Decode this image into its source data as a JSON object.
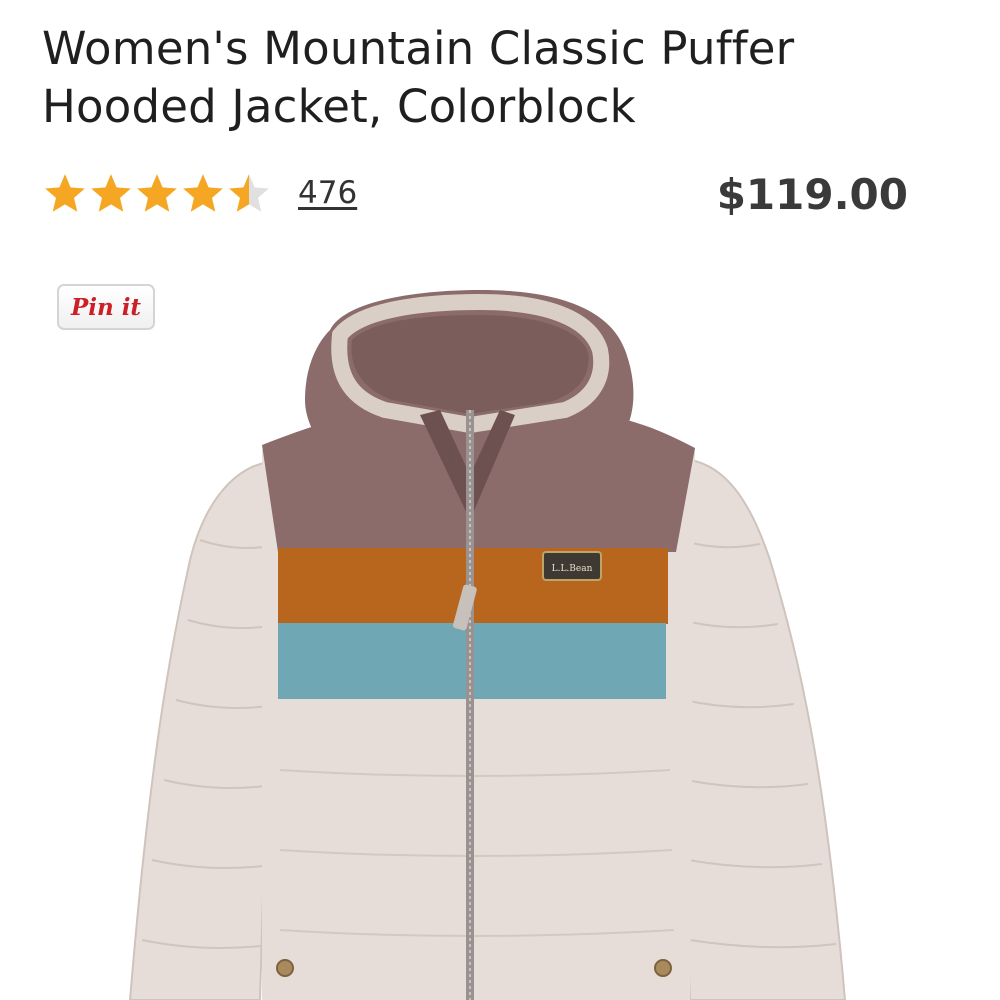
{
  "product": {
    "title": "Women's Mountain Classic Puffer Hooded Jacket, Colorblock",
    "rating_value": 4.5,
    "rating_max": 5,
    "review_count": "476",
    "price": "$119.00"
  },
  "share": {
    "pin_label": "Pin it"
  },
  "image": {
    "logo_text": "L.L.Bean",
    "colors": {
      "body": "#e7ddd8",
      "yoke": "#8b6c6b",
      "hood_lining": "#7b5d5c",
      "orange_band": "#b8651e",
      "blue_band": "#6fa7b5",
      "trim": "#d9cfc6",
      "zipper": "#9a9290"
    }
  },
  "theme": {
    "star_color": "#f5a623",
    "star_empty_color": "#e0e0e0",
    "text_color": "#1f1f1f",
    "pin_color": "#cb2027"
  },
  "icons": {
    "star": "star-icon",
    "pin": "pinterest-pin-it-icon"
  }
}
